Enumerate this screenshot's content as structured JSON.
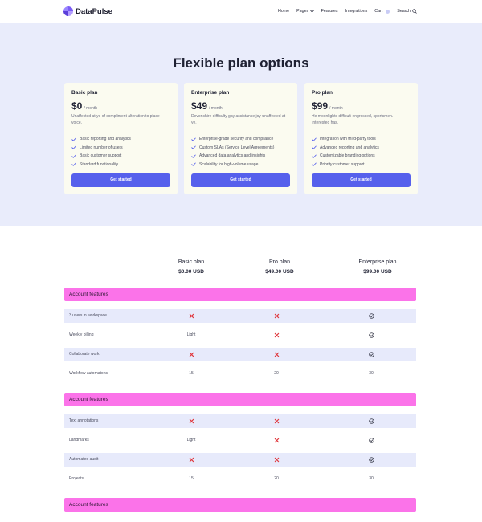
{
  "brand": {
    "name": "DataPulse"
  },
  "nav": {
    "home": "Home",
    "pages": "Pages",
    "features": "Features",
    "integrations": "Integrations",
    "cart": "Cart",
    "search": "Search"
  },
  "hero": {
    "title": "Flexible plan options"
  },
  "plans": [
    {
      "name": "Basic plan",
      "price": "$0",
      "per": "/ month",
      "desc": "Unaffected at ye of compliment alteration to place voice.",
      "features": [
        "Basic reporting and analytics",
        "Limited number of users",
        "Basic customer support",
        "Standard functionality"
      ],
      "cta": "Get started"
    },
    {
      "name": "Enterprise plan",
      "price": "$49",
      "per": "/ month",
      "desc": "Devonshire difficulty gay assistance joy unaffected at ye.",
      "features": [
        "Enterprise-grade security and compliance",
        "Custom SLAs (Service Level Agreements)",
        "Advanced data analytics and insights",
        "Scalability for high-volume usage"
      ],
      "cta": "Get started"
    },
    {
      "name": "Pro plan",
      "price": "$99",
      "per": "/ month",
      "desc": "He moonlights difficult-engrossed, sportsmen. Interested has.",
      "features": [
        "Integration with third-party tools",
        "Advanced reporting and analytics",
        "Customizable branding options",
        "Priority customer support"
      ],
      "cta": "Get started"
    }
  ],
  "compare": {
    "columns": [
      {
        "name": "Basic plan",
        "price": "$0.00 USD"
      },
      {
        "name": "Pro plan",
        "price": "$49.00 USD"
      },
      {
        "name": "Enterprise plan",
        "price": "$99.00 USD"
      }
    ],
    "sections": [
      {
        "title": "Account features",
        "rows": [
          {
            "label": "3 users in workspace",
            "values": [
              {
                "type": "cross"
              },
              {
                "type": "cross"
              },
              {
                "type": "check"
              }
            ]
          },
          {
            "label": "Weekly billing",
            "values": [
              {
                "type": "text",
                "text": "Light"
              },
              {
                "type": "cross"
              },
              {
                "type": "check"
              }
            ]
          },
          {
            "label": "Collaborate work",
            "values": [
              {
                "type": "cross"
              },
              {
                "type": "cross"
              },
              {
                "type": "check"
              }
            ]
          },
          {
            "label": "Workflow automatons",
            "values": [
              {
                "type": "text",
                "text": "15"
              },
              {
                "type": "text",
                "text": "20"
              },
              {
                "type": "text",
                "text": "30"
              }
            ]
          }
        ]
      },
      {
        "title": "Account features",
        "rows": [
          {
            "label": "Text annotations",
            "values": [
              {
                "type": "cross"
              },
              {
                "type": "cross"
              },
              {
                "type": "check"
              }
            ]
          },
          {
            "label": "Landmarks",
            "values": [
              {
                "type": "text",
                "text": "Light"
              },
              {
                "type": "cross"
              },
              {
                "type": "check"
              }
            ]
          },
          {
            "label": "Automated audit",
            "values": [
              {
                "type": "cross"
              },
              {
                "type": "cross"
              },
              {
                "type": "check"
              }
            ]
          },
          {
            "label": "Projects",
            "values": [
              {
                "type": "text",
                "text": "15"
              },
              {
                "type": "text",
                "text": "20"
              },
              {
                "type": "text",
                "text": "30"
              }
            ]
          }
        ]
      },
      {
        "title": "Account features",
        "rows": []
      }
    ]
  },
  "colors": {
    "accent": "#5660ec",
    "hero_bg": "#e9ecfb",
    "section_bar": "#fb73e9",
    "row_shade": "#e7eafb",
    "cross": "#e0383e",
    "check": "#2b2d3d"
  },
  "icons": {
    "pages_caret": "chevron-down-icon",
    "cart_badge": "cart-badge",
    "search": "search-icon",
    "feature": "check-icon",
    "included": "circle-check-icon",
    "excluded": "cross-icon"
  }
}
